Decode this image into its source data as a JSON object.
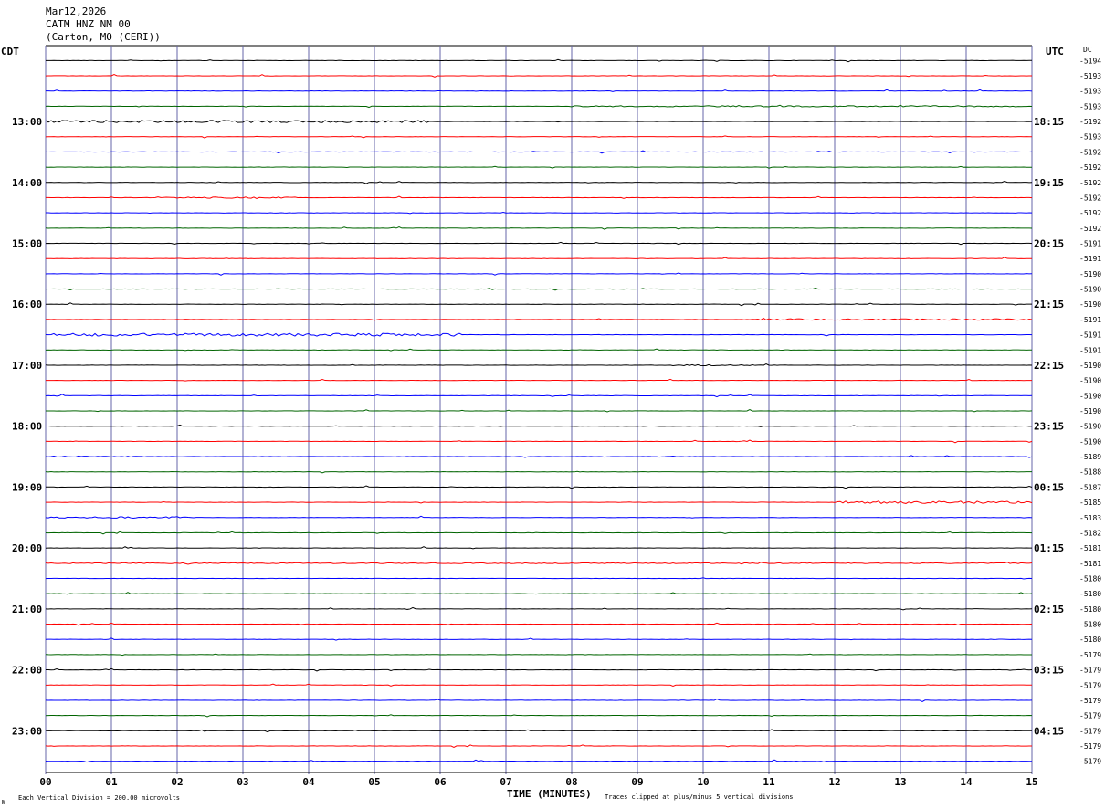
{
  "header": {
    "date": "Mar12,2026",
    "station": "CATM HNZ NM 00",
    "location": "(Carton, MO (CERI))"
  },
  "footer": {
    "scale_note": "Each Vertical Division =  200.00 microvolts",
    "clip_note": "Traces clipped at plus/minus 5 vertical divisions",
    "corner_mark": "ᴍ"
  },
  "chart_data": {
    "type": "line",
    "title": "",
    "xlabel": "TIME (MINUTES)",
    "left_axis_label": "CDT",
    "right_axis_label": "UTC",
    "dc_label": "DC",
    "xlim": [
      0,
      15
    ],
    "x_ticks": [
      "00",
      "01",
      "02",
      "03",
      "04",
      "05",
      "06",
      "07",
      "08",
      "09",
      "10",
      "11",
      "12",
      "13",
      "14",
      "15"
    ],
    "grid": true,
    "trace_colors": [
      "#000000",
      "#ff0000",
      "#0000ff",
      "#006400"
    ],
    "grid_color": "#6666aa",
    "left_hour_labels": [
      "13:00",
      "14:00",
      "15:00",
      "16:00",
      "17:00",
      "18:00",
      "19:00",
      "20:00",
      "21:00",
      "22:00",
      "23:00"
    ],
    "right_hour_labels": [
      "18:15",
      "19:15",
      "20:15",
      "21:15",
      "22:15",
      "23:15",
      "00:15",
      "01:15",
      "02:15",
      "03:15",
      "04:15"
    ],
    "dc_values": [
      "-5194",
      "-5193",
      "-5193",
      "-5193",
      "-5192",
      "-5193",
      "-5192",
      "-5192",
      "-5192",
      "-5192",
      "-5192",
      "-5192",
      "-5191",
      "-5191",
      "-5190",
      "-5190",
      "-5190",
      "-5191",
      "-5191",
      "-5191",
      "-5190",
      "-5190",
      "-5190",
      "-5190",
      "-5190",
      "-5190",
      "-5189",
      "-5188",
      "-5187",
      "-5185",
      "-5183",
      "-5182",
      "-5181",
      "-5181",
      "-5180",
      "-5180",
      "-5180",
      "-5180",
      "-5180",
      "-5179",
      "-5179",
      "-5179",
      "-5179",
      "-5179",
      "-5179",
      "-5179",
      "-5179"
    ],
    "bursts": [
      {
        "trace": 4,
        "x0": 0.0,
        "x1": 5.8,
        "amp": 2.5
      },
      {
        "trace": 3,
        "x0": 8.0,
        "x1": 15.0,
        "amp": 1.3
      },
      {
        "trace": 9,
        "x0": 1.7,
        "x1": 3.8,
        "amp": 1.4
      },
      {
        "trace": 17,
        "x0": 10.6,
        "x1": 15.0,
        "amp": 1.5
      },
      {
        "trace": 18,
        "x0": 0.1,
        "x1": 6.3,
        "amp": 3.0
      },
      {
        "trace": 20,
        "x0": 9.7,
        "x1": 10.8,
        "amp": 1.2
      },
      {
        "trace": 29,
        "x0": 12.0,
        "x1": 15.0,
        "amp": 2.6
      },
      {
        "trace": 30,
        "x0": 0.0,
        "x1": 2.2,
        "amp": 1.6
      },
      {
        "trace": 33,
        "x0": 0.0,
        "x1": 15.0,
        "amp": 0.9
      },
      {
        "trace": 26,
        "x0": 0.0,
        "x1": 1.5,
        "amp": 1.0
      }
    ]
  }
}
